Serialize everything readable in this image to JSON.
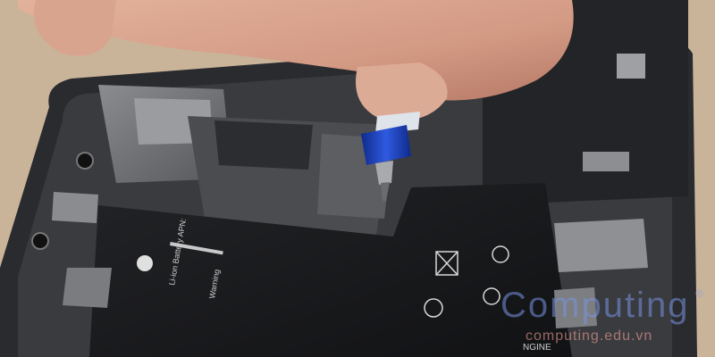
{
  "photo": {
    "subject": "iPhone internals with screwdriver",
    "battery_text": {
      "brand_line": "Li-ion Battery APN:",
      "warning": "Warning"
    },
    "engine_label": "NGINE"
  },
  "watermark": {
    "name": "Computing",
    "registered": "®",
    "url": "computing.edu.vn"
  },
  "colors": {
    "table": "#c9b49a",
    "phone_frame": "#2a2b2e",
    "battery": "#1a1b1d",
    "shield": "#6e7074",
    "screwdriver_blue": "#1b3fb8",
    "skin": "#d9a48e"
  }
}
